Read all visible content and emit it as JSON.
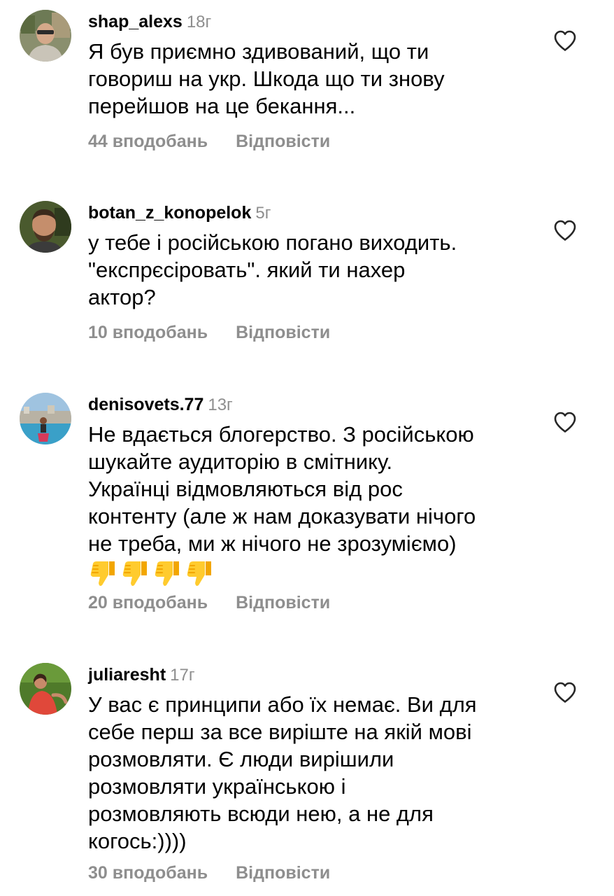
{
  "comments": [
    {
      "username": "shap_alexs",
      "time": "18г",
      "lines": [
        "Я був приємно здивований, що ти",
        "говориш на укр. Шкода що ти знову",
        "перейшов на це бекання..."
      ],
      "likes": "44 вподобань",
      "reply": "Відповісти",
      "avatar_icon": "avatar-photo-man-glasses"
    },
    {
      "username": "botan_z_konopelok",
      "time": "5г",
      "lines": [
        "у тебе і російською погано виходить.",
        "\"експрєсіровать\". який ти нахер",
        "актор?"
      ],
      "likes": "10 вподобань",
      "reply": "Відповісти",
      "avatar_icon": "avatar-photo-bearded-man"
    },
    {
      "username": "denisovets.77",
      "time": "13г",
      "lines": [
        "Не вдається блогерство. З російською",
        "шукайте аудиторію в смітнику.",
        "Українці відмовляються від рос",
        "контенту (але ж нам доказувати нічого",
        "не треба, ми ж нічого не зрозуміємо)"
      ],
      "emojis": [
        "thumbs-down-emoji",
        "thumbs-down-emoji",
        "thumbs-down-emoji",
        "thumbs-down-emoji"
      ],
      "likes": "20 вподобань",
      "reply": "Відповісти",
      "avatar_icon": "avatar-photo-woman-seaside"
    },
    {
      "username": "juliaresht",
      "time": "17г",
      "lines": [
        "У вас є принципи або їх немає. Ви для",
        "себе перш за все вирiште на якiй мовi",
        "розмовляти. Є люди вирішили",
        "розмовляти українською і",
        "розмовляють всюди нею, а не для",
        "когось:))))"
      ],
      "likes": "30 вподобань",
      "reply": "Відповісти",
      "avatar_icon": "avatar-photo-woman-red"
    }
  ],
  "colors": {
    "text": "#000000",
    "secondary": "#8e8e8e",
    "emoji_yellow": "#ffcb2e",
    "emoji_shade": "#f2a600"
  },
  "icons": {
    "like": "heart-outline-icon"
  }
}
